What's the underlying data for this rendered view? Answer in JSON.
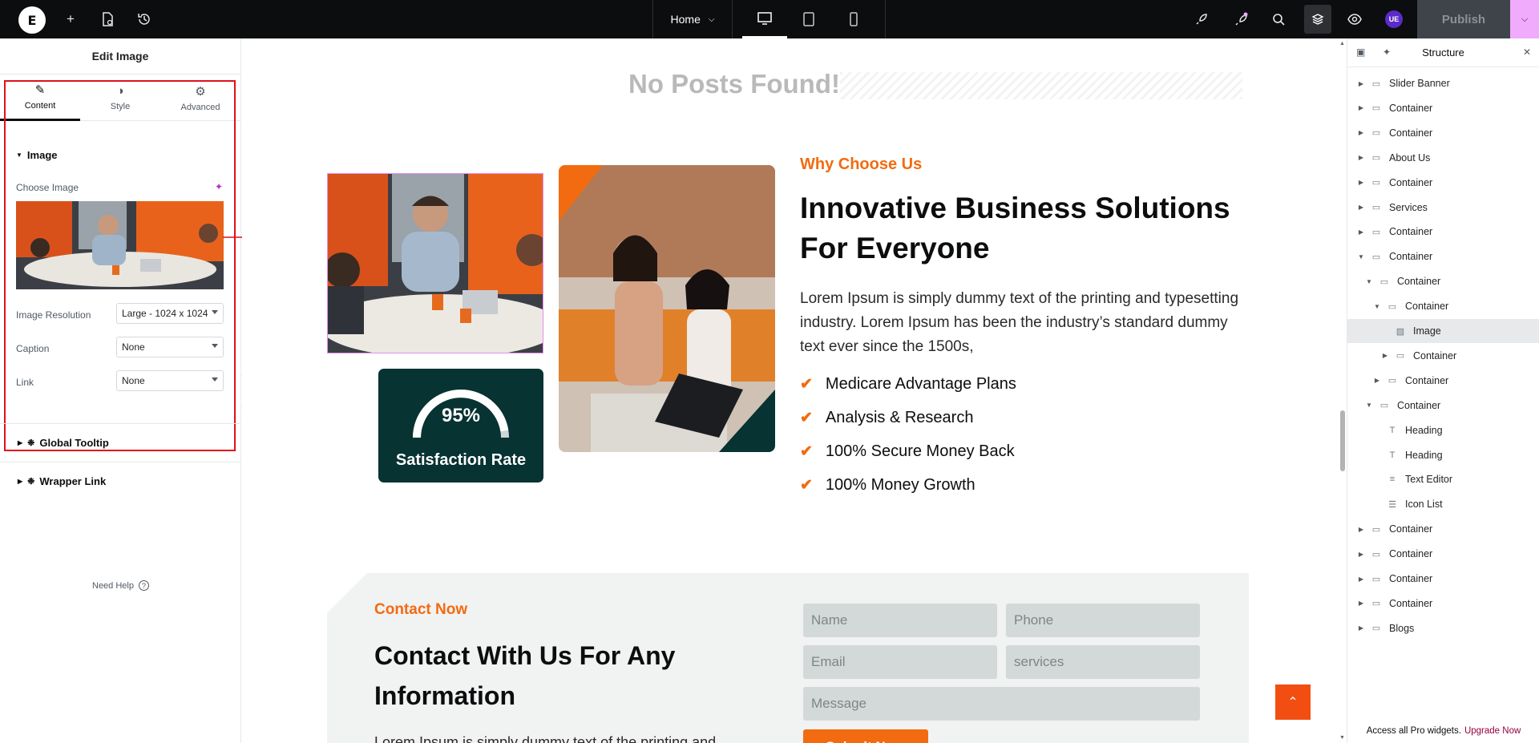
{
  "topbar": {
    "logo_letter": "E",
    "page": "Home",
    "publish_label": "Publish",
    "avatar_initials": "UE",
    "accent_color": "#f0abfc"
  },
  "left_panel": {
    "title": "Edit Image",
    "tabs": [
      {
        "label": "Content",
        "icon": "pencil-icon"
      },
      {
        "label": "Style",
        "icon": "half-circle-icon"
      },
      {
        "label": "Advanced",
        "icon": "gear-icon"
      }
    ],
    "section_image": "Image",
    "choose_image_label": "Choose Image",
    "image_resolution_label": "Image Resolution",
    "image_resolution_value": "Large - 1024 x 1024",
    "caption_label": "Caption",
    "caption_value": "None",
    "link_label": "Link",
    "link_value": "None",
    "global_tooltip": "Global Tooltip",
    "wrapper_link": "Wrapper Link",
    "need_help": "Need Help",
    "highlight_color": "#e0101c"
  },
  "canvas": {
    "no_posts": "No Posts Found!",
    "why_kicker": "Why Choose Us",
    "headline_line1": "Innovative Business Solutions",
    "headline_line2": "For Everyone",
    "paragraph": "Lorem Ipsum is simply dummy text of the printing and typesetting industry. Lorem Ipsum has been the industry’s standard dummy text ever since the 1500s,",
    "features": [
      "Medicare Advantage Plans",
      "Analysis & Research",
      "100% Secure Money Back",
      "100% Money Growth"
    ],
    "stat_percent": "95%",
    "stat_label": "Satisfaction Rate",
    "stat_progress": 0.95,
    "contact_kicker": "Contact Now",
    "contact_title_line1": "Contact With Us For Any",
    "contact_title_line2": "Information",
    "contact_text": "Lorem Ipsum is simply dummy text of the printing and",
    "form": {
      "name_placeholder": "Name",
      "phone_placeholder": "Phone",
      "email_placeholder": "Email",
      "services_placeholder": "services",
      "message_placeholder": "Message",
      "submit_label": "Submit Now"
    },
    "brand_orange": "#f26b10",
    "brand_teal": "#073332"
  },
  "structure": {
    "title": "Structure",
    "items": [
      {
        "label": "Slider Banner",
        "depth": 0,
        "arrow": "right",
        "icon": "container-icon"
      },
      {
        "label": "Container",
        "depth": 0,
        "arrow": "right",
        "icon": "container-icon"
      },
      {
        "label": "Container",
        "depth": 0,
        "arrow": "right",
        "icon": "container-icon"
      },
      {
        "label": "About Us",
        "depth": 0,
        "arrow": "right",
        "icon": "container-icon"
      },
      {
        "label": "Container",
        "depth": 0,
        "arrow": "right",
        "icon": "container-icon"
      },
      {
        "label": "Services",
        "depth": 0,
        "arrow": "right",
        "icon": "container-icon"
      },
      {
        "label": "Container",
        "depth": 0,
        "arrow": "right",
        "icon": "container-icon"
      },
      {
        "label": "Container",
        "depth": 0,
        "arrow": "down",
        "icon": "container-icon"
      },
      {
        "label": "Container",
        "depth": 1,
        "arrow": "down",
        "icon": "container-icon"
      },
      {
        "label": "Container",
        "depth": 2,
        "arrow": "down",
        "icon": "container-icon"
      },
      {
        "label": "Image",
        "depth": 3,
        "arrow": "none",
        "icon": "image-icon",
        "selected": true
      },
      {
        "label": "Container",
        "depth": 3,
        "arrow": "right",
        "icon": "container-icon"
      },
      {
        "label": "Container",
        "depth": 2,
        "arrow": "right",
        "icon": "container-icon"
      },
      {
        "label": "Container",
        "depth": 1,
        "arrow": "down",
        "icon": "container-icon"
      },
      {
        "label": "Heading",
        "depth": 2,
        "arrow": "none",
        "icon": "heading-icon"
      },
      {
        "label": "Heading",
        "depth": 2,
        "arrow": "none",
        "icon": "heading-icon"
      },
      {
        "label": "Text Editor",
        "depth": 2,
        "arrow": "none",
        "icon": "text-editor-icon"
      },
      {
        "label": "Icon List",
        "depth": 2,
        "arrow": "none",
        "icon": "icon-list-icon"
      },
      {
        "label": "Container",
        "depth": 0,
        "arrow": "right",
        "icon": "container-icon"
      },
      {
        "label": "Container",
        "depth": 0,
        "arrow": "right",
        "icon": "container-icon"
      },
      {
        "label": "Container",
        "depth": 0,
        "arrow": "right",
        "icon": "container-icon"
      },
      {
        "label": "Container",
        "depth": 0,
        "arrow": "right",
        "icon": "container-icon"
      },
      {
        "label": "Blogs",
        "depth": 0,
        "arrow": "right",
        "icon": "container-icon"
      }
    ],
    "footer_text": "Access all Pro widgets.",
    "footer_link": "Upgrade Now"
  }
}
